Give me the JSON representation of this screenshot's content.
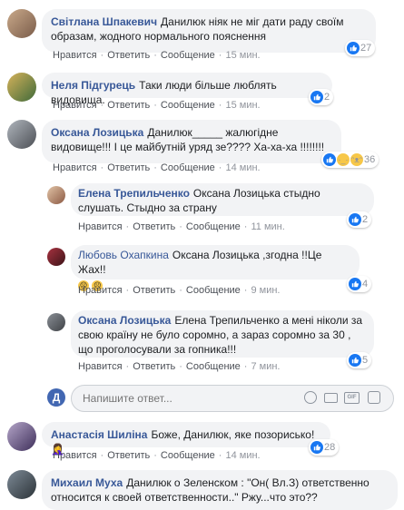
{
  "actions": {
    "like": "Нравится",
    "reply": "Ответить",
    "message": "Сообщение"
  },
  "comments": [
    {
      "author": "Світлана Шпакевич",
      "text": "Данилюк ніяк не міг дати раду своїм образам, жодного нормального пояснення",
      "time": "15 мин.",
      "reactions": "27"
    },
    {
      "author": "Неля Підгурець",
      "text": "Таки люди більше люблять видовища.",
      "time": "15 мин.",
      "reactions": "2"
    },
    {
      "author": "Оксана Лозицька",
      "text": "Данилюк_____ жалюгідне видовище!!! І це майбутній уряд зе???? Ха-ха-ха !!!!!!!!",
      "time": "14 мин.",
      "reactions": "36"
    }
  ],
  "replies": [
    {
      "author": "Елена Трепильченко",
      "text": "Оксана Лозицька стыдно слушать. Стыдно за страну",
      "time": "11 мин.",
      "reactions": "2"
    },
    {
      "author": "Любовь Охапкина",
      "text": "Оксана Лозицька ,згодна !!Це Жах!!",
      "time": "9 мин.",
      "reactions": "4"
    },
    {
      "author": "Оксана Лозицька",
      "text": "Елена Трепильченко а мені ніколи за свою країну не було соромно, а зараз соромно за 30 , що проголосували за гопника!!!",
      "time": "7 мин.",
      "reactions": "5"
    }
  ],
  "reply_box": {
    "placeholder": "Напишите ответ..."
  },
  "bottom": [
    {
      "author": "Анастасія Шиліна",
      "text": "Боже, Данилюк, яке позорисько! 🤦‍♀️",
      "time": "14 мин.",
      "reactions": "28"
    },
    {
      "author": "Михаил Муха",
      "text": "Данилюк о Зеленском : \"Он( Вл.З) ответственно относится к своей ответственности..\" Ржу...что это??"
    }
  ],
  "colors": {
    "link": "#385898",
    "bubble": "#f2f3f5",
    "like": "#1877f2"
  }
}
